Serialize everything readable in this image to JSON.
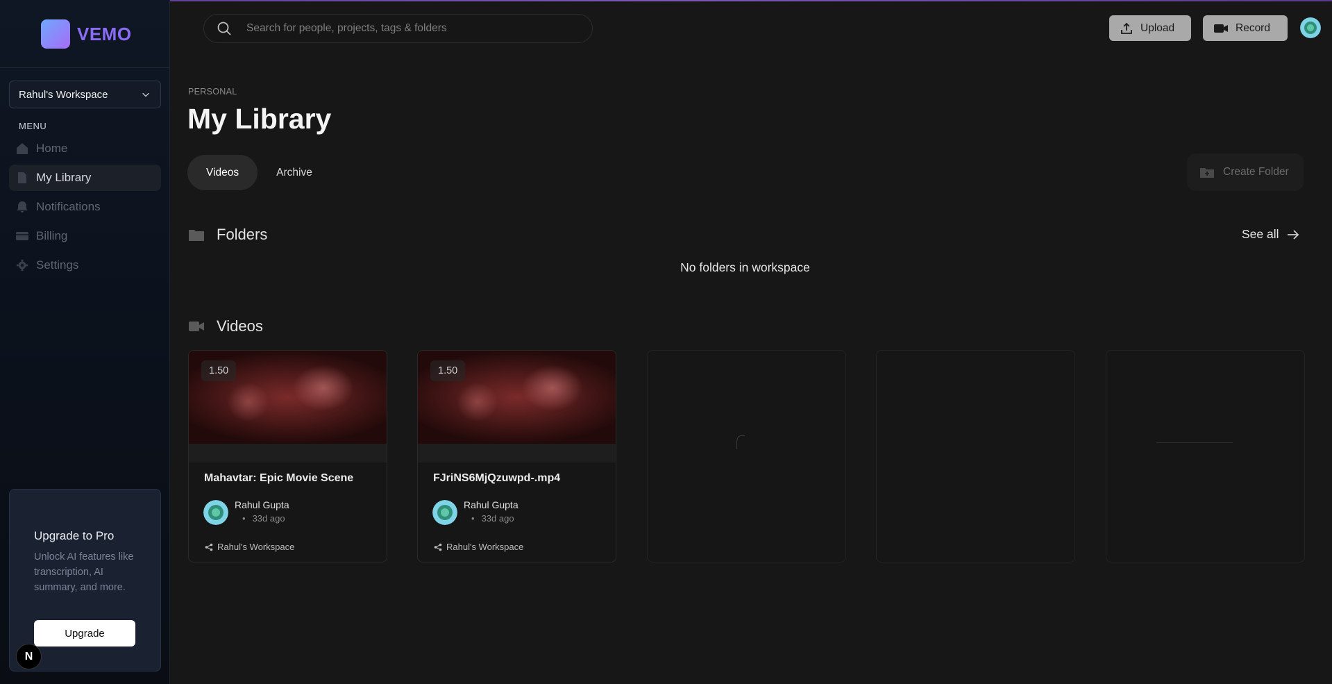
{
  "brand": {
    "name": "VEMO"
  },
  "sidebar": {
    "workspace": "Rahul's Workspace",
    "menu_label": "MENU",
    "items": [
      {
        "label": "Home",
        "icon": "home-icon"
      },
      {
        "label": "My Library",
        "icon": "file-icon",
        "active": true
      },
      {
        "label": "Notifications",
        "icon": "bell-icon"
      },
      {
        "label": "Billing",
        "icon": "credit-card-icon"
      },
      {
        "label": "Settings",
        "icon": "gear-icon"
      }
    ],
    "upgrade": {
      "title": "Upgrade to Pro",
      "description": "Unlock AI features like transcription, AI summary, and more.",
      "button": "Upgrade"
    },
    "badge": "N"
  },
  "topbar": {
    "search_placeholder": "Search for people, projects, tags & folders",
    "upload": "Upload",
    "record": "Record"
  },
  "main": {
    "breadcrumb": "PERSONAL",
    "title": "My Library",
    "tabs": [
      {
        "label": "Videos",
        "active": true
      },
      {
        "label": "Archive"
      }
    ],
    "create_folder": "Create Folder",
    "folders": {
      "heading": "Folders",
      "see_all": "See all",
      "empty": "No folders in workspace"
    },
    "videos": {
      "heading": "Videos",
      "items": [
        {
          "speed": "1.50",
          "title": "Mahavtar: Epic Movie Scene",
          "author": "Rahul Gupta",
          "ago": "33d ago",
          "workspace": "Rahul's Workspace"
        },
        {
          "speed": "1.50",
          "title": "FJriNS6MjQzuwpd-.mp4",
          "author": "Rahul Gupta",
          "ago": "33d ago",
          "workspace": "Rahul's Workspace"
        }
      ]
    }
  },
  "colors": {
    "background": "#171717",
    "sidebar": "#0f1724",
    "brand": "#8b6cf6",
    "top_button": "#a9a9a9"
  }
}
